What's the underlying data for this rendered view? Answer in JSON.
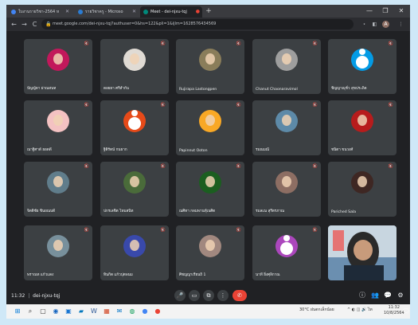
{
  "browser": {
    "tabs": [
      {
        "label": "ใบงานรายวิชา-2564 ห",
        "color": "#4285f4",
        "active": false
      },
      {
        "label": "รายวิชาครู - Microso",
        "color": "#2b7cd3",
        "active": false
      },
      {
        "label": "Meet - dei-njxu-tqj",
        "color": "#00897b",
        "active": true
      }
    ],
    "new_tab": "+",
    "window_controls": [
      "—",
      "❐",
      "✕"
    ],
    "nav": [
      "←",
      "→",
      "C"
    ],
    "url": "meet.google.com/dei-njxu-tqj?authuser=0&hs=122&pli=1&ijlm=1628576434569",
    "lock_icon": "🔒",
    "extensions": [
      "⋆",
      "◧",
      "A",
      "⋮"
    ]
  },
  "participants": [
    {
      "name": "ปัญญ์ดา ผ่าณสนท",
      "avatar": "photo",
      "color": "#c2185b"
    },
    {
      "name": "ดอยยา ศรีสำกัน",
      "avatar": "photo",
      "color": "#e0dbd4"
    },
    {
      "name": "Rujirapa Lastongpen",
      "avatar": "photo",
      "color": "#8a7d5a"
    },
    {
      "name": "Chanut Chaonaravimol",
      "avatar": "photo",
      "color": "#9e9e9e"
    },
    {
      "name": "ชิญญาณุชั่ว สุขประถิต",
      "avatar": "initial",
      "color": "#039be5"
    },
    {
      "name": "ณาฐิศาต์ ยอดดี",
      "avatar": "photo",
      "color": "#f4c2c2"
    },
    {
      "name": "ฐิติรัตน์ กนธาก",
      "avatar": "initial",
      "color": "#e64a19"
    },
    {
      "name": "Papinnut Ooton",
      "avatar": "photo",
      "color": "#f9a825"
    },
    {
      "name": "รมณมณี",
      "avatar": "photo",
      "color": "#5d8aa8"
    },
    {
      "name": "ชนิตา ขนวงศ์",
      "avatar": "photo",
      "color": "#b71c1c"
    },
    {
      "name": "จิตติชัย ชินยณบดี",
      "avatar": "photo",
      "color": "#607d8b"
    },
    {
      "name": "ปกรเลชิต ไหมสนิท",
      "avatar": "photo",
      "color": "#4a6b3a"
    },
    {
      "name": "ณศิทา กลมพานทุ์เนศิต",
      "avatar": "photo",
      "color": "#1b5e20"
    },
    {
      "name": "รมลเณ สุรีตรภาณ",
      "avatar": "photo",
      "color": "#8d6e63"
    },
    {
      "name": "Pariched Sala",
      "avatar": "photo",
      "color": "#3e2723"
    },
    {
      "name": "พราณท แก้วแดง",
      "avatar": "photo",
      "color": "#78909c"
    },
    {
      "name": "ทินกิต แก้วปุดพนม",
      "avatar": "photo",
      "color": "#3949ab"
    },
    {
      "name": "ศิชญญาเรียนถิ 1",
      "avatar": "photo",
      "color": "#a1887f"
    },
    {
      "name": "นาที ยิ่งศุลิกาณ",
      "avatar": "initial",
      "color": "#ab47bc"
    }
  ],
  "meeting": {
    "time": "11:32",
    "code": "dei-njxu-tqj",
    "controls": {
      "mic": "🎤",
      "camera": "▭",
      "present": "⧉",
      "more": "⋮",
      "end": "✆"
    },
    "right_icons": [
      "ⓘ",
      "👥",
      "💬",
      "⚙"
    ]
  },
  "taskbar": {
    "icons": [
      {
        "glyph": "⊞",
        "color": "#0078d7"
      },
      {
        "glyph": "⌕",
        "color": "#333"
      },
      {
        "glyph": "▢",
        "color": "#333"
      },
      {
        "glyph": "◉",
        "color": "#1565c0"
      },
      {
        "glyph": "▣",
        "color": "#1976d2"
      },
      {
        "glyph": "▰",
        "color": "#0277bd"
      },
      {
        "glyph": "W",
        "color": "#2b5797"
      },
      {
        "glyph": "▦",
        "color": "#d24726"
      },
      {
        "glyph": "✉",
        "color": "#0072c6"
      },
      {
        "glyph": "◍",
        "color": "#0f9d58"
      },
      {
        "glyph": "●",
        "color": "#4285f4"
      },
      {
        "glyph": "●",
        "color": "#ea4335"
      }
    ],
    "tray_weather": "30°C ฝนตกเล็กน้อย",
    "tray_symbols": "^ ◐ ◫ 🔊 ไท",
    "clock_time": "11:32",
    "clock_date": "10/8/2564"
  }
}
